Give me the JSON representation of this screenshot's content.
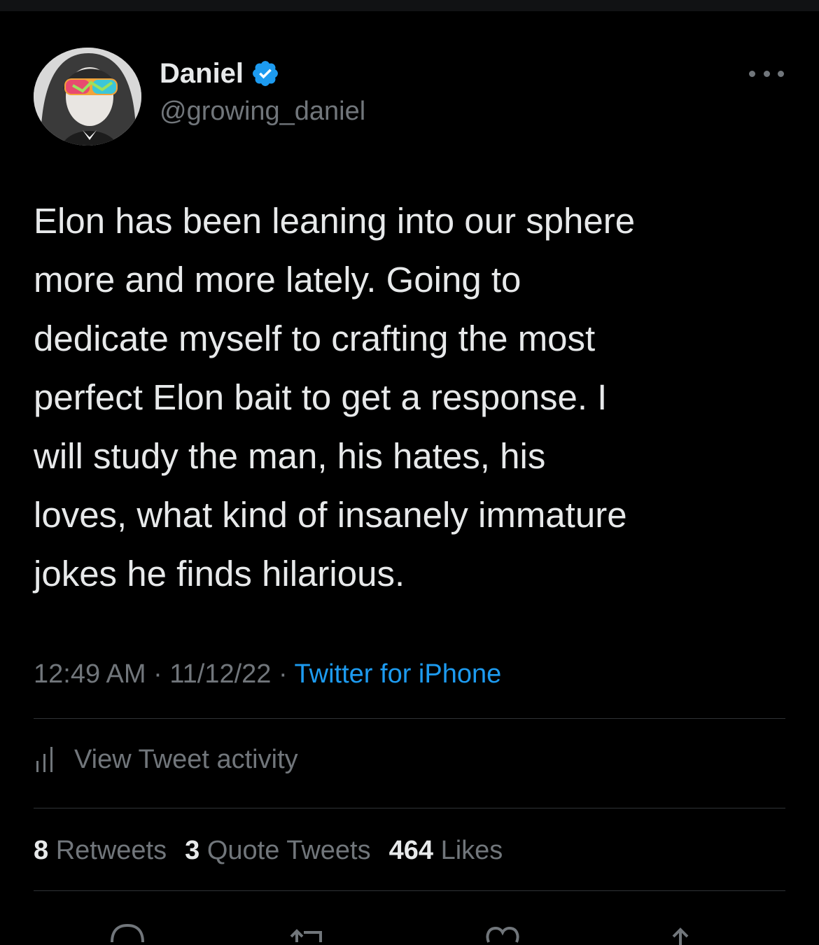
{
  "tweet": {
    "author": {
      "name": "Daniel",
      "handle": "@growing_daniel",
      "verified": true
    },
    "text": "Elon has been leaning into our sphere\nmore and more lately. Going to\ndedicate myself to crafting the most\nperfect Elon bait to get a response. I\nwill study the man, his hates, his\nloves, what kind of insanely immature\njokes he finds hilarious.",
    "time": "12:49 AM",
    "date": "11/12/22",
    "separator": "·",
    "source": "Twitter for iPhone",
    "activity_label": "View Tweet activity",
    "stats": [
      {
        "count": "8",
        "label": "Retweets"
      },
      {
        "count": "3",
        "label": "Quote Tweets"
      },
      {
        "count": "464",
        "label": "Likes"
      }
    ]
  },
  "icons": [
    "verified-badge-icon",
    "more-options-icon",
    "bar-chart-icon",
    "reply-icon",
    "retweet-icon",
    "like-icon",
    "share-icon"
  ],
  "colors": {
    "background": "#000000",
    "text_primary": "#e7e9ea",
    "text_secondary": "#71767b",
    "accent": "#1d9bf0",
    "divider": "#2f3336"
  }
}
